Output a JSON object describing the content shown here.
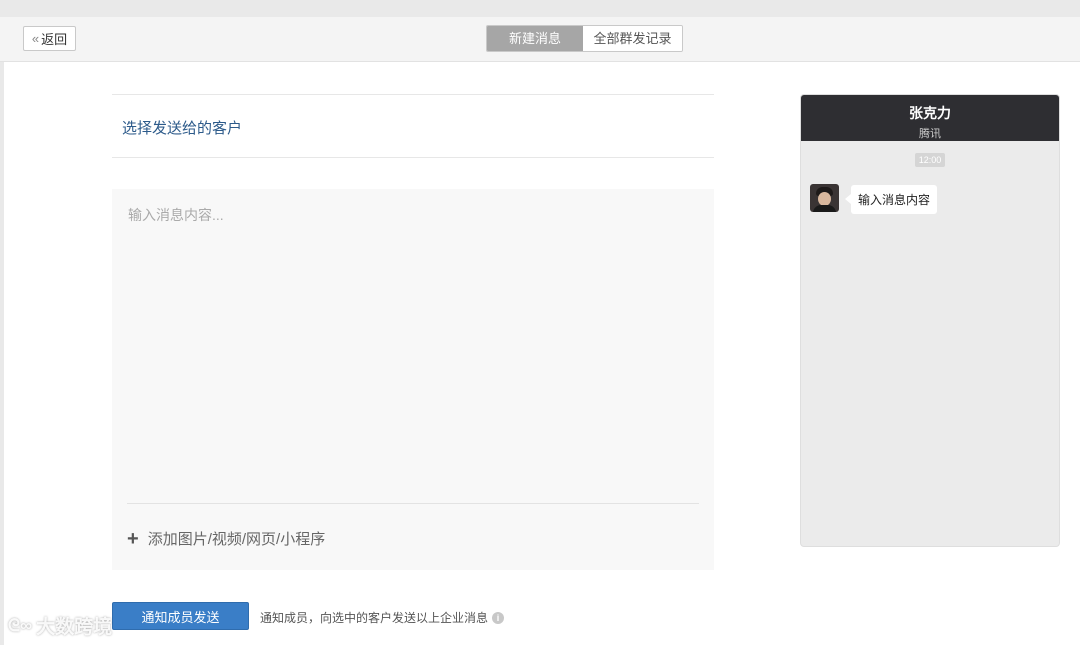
{
  "topbar": {
    "back_label": "返回",
    "back_icon": "double-chevron-left-icon",
    "tabs": [
      {
        "label": "新建消息",
        "active": true
      },
      {
        "label": "全部群发记录",
        "active": false
      }
    ]
  },
  "form": {
    "select_customer_label": "选择发送给的客户",
    "message_placeholder": "输入消息内容...",
    "attach_label": "添加图片/视频/网页/小程序",
    "send_button": "通知成员发送",
    "send_note": "通知成员，向选中的客户发送以上企业消息"
  },
  "preview": {
    "name": "张克力",
    "company": "腾讯",
    "time": "12:00",
    "message": "输入消息内容"
  },
  "watermark": {
    "text": "大数跨境"
  },
  "colors": {
    "accent": "#3a7ec7",
    "link": "#2c5a8a",
    "phone_header": "#2e2e32",
    "tab_active": "#a6a6a6"
  }
}
